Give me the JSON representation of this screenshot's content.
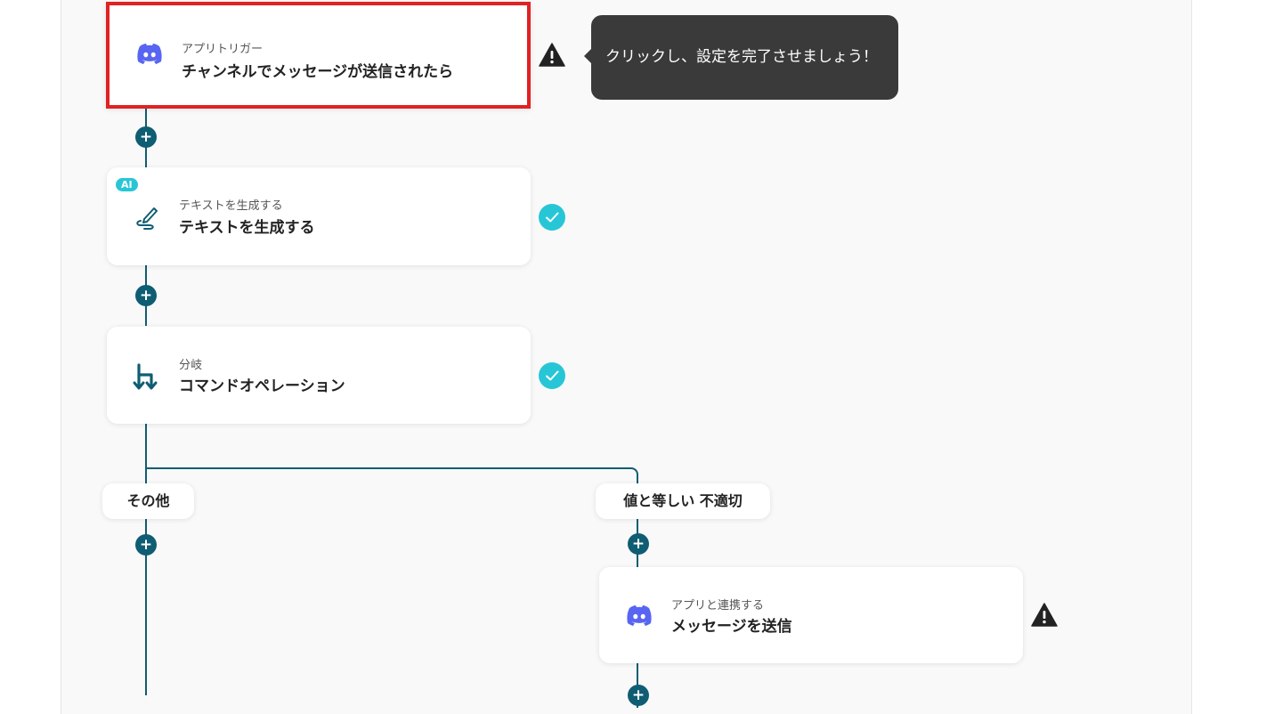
{
  "trigger": {
    "category": "アプリトリガー",
    "title": "チャンネルでメッセージが送信されたら",
    "icon": "discord-icon",
    "status": "warning"
  },
  "tooltip": {
    "text": "クリックし、設定を完了させましょう！"
  },
  "ai_step": {
    "badge": "AI",
    "category": "テキストを生成する",
    "title": "テキストを生成する",
    "icon": "pen-icon",
    "status": "complete"
  },
  "branch_step": {
    "category": "分岐",
    "title": "コマンドオペレーション",
    "icon": "branch-icon",
    "status": "complete"
  },
  "branches": {
    "left_label": "その他",
    "right_label": "値と等しい 不適切"
  },
  "send_step": {
    "category": "アプリと連携する",
    "title": "メッセージを送信",
    "icon": "discord-icon",
    "status": "warning"
  },
  "colors": {
    "accent": "#0f5d73",
    "success": "#27c6d6",
    "warning": "#222222",
    "highlight": "#e12222",
    "discord": "#5865f2"
  }
}
